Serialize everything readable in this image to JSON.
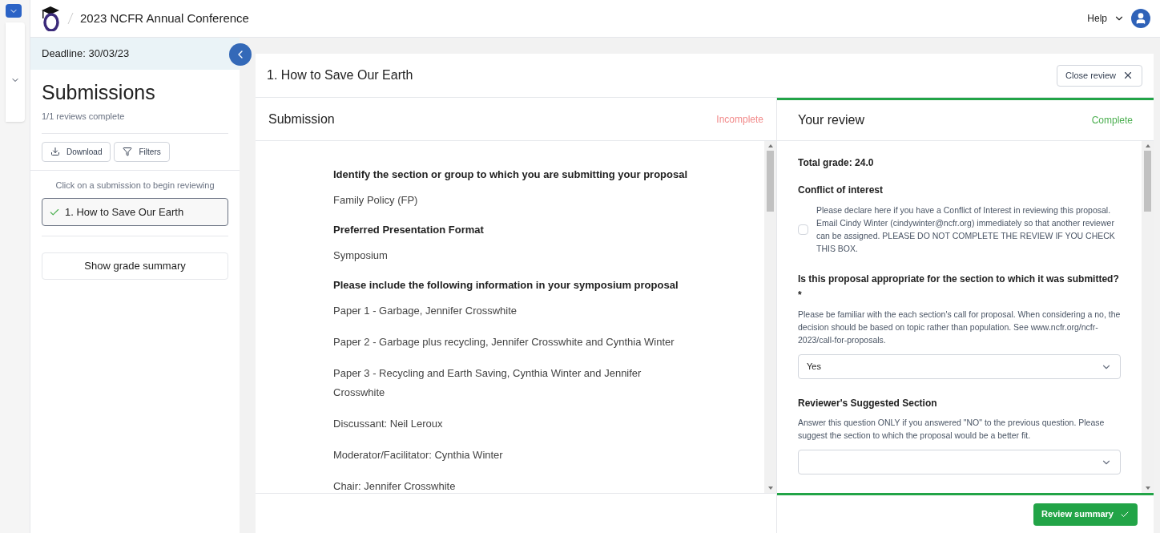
{
  "header": {
    "title": "2023 NCFR Annual Conference",
    "help": "Help"
  },
  "sidebar": {
    "deadline": "Deadline: 30/03/23",
    "title": "Submissions",
    "progress": "1/1 reviews complete",
    "buttons": [
      "Download",
      "Filters"
    ],
    "hint": "Click on a submission to begin reviewing",
    "items": [
      {
        "label": "1. How to Save Our Earth",
        "selected": true,
        "completed": true
      }
    ],
    "summary_button": "Show grade summary"
  },
  "main": {
    "title": "1. How to Save Our Earth",
    "close_button": "Close review",
    "submission": {
      "title": "Submission",
      "status": {
        "kind": "incomplete",
        "text": "Incomplete"
      },
      "blocks": [
        {
          "kind": "question",
          "text": "Identify the section or group to which you are submitting your proposal"
        },
        {
          "kind": "answer",
          "text": "Family Policy (FP)"
        },
        {
          "kind": "question",
          "text": "Preferred Presentation Format"
        },
        {
          "kind": "answer",
          "text": "Symposium"
        },
        {
          "kind": "question",
          "text": "Please include the following information in your symposium proposal"
        },
        {
          "kind": "answer",
          "text": "Paper 1 - Garbage, Jennifer Crosswhite"
        },
        {
          "kind": "answer",
          "text": "Paper 2 - Garbage plus recycling, Jennifer Crosswhite and Cynthia Winter"
        },
        {
          "kind": "answer",
          "text": "Paper 3 - Recycling and Earth Saving, Cynthia Winter and Jennifer Crosswhite"
        },
        {
          "kind": "answer",
          "text": "Discussant: Neil Leroux"
        },
        {
          "kind": "answer",
          "text": "Moderator/Facilitator: Cynthia Winter"
        },
        {
          "kind": "answer",
          "text": "Chair: Jennifer Crosswhite"
        }
      ]
    },
    "review": {
      "title": "Your review",
      "status": {
        "kind": "complete",
        "text": "Complete"
      },
      "total": "Total grade: 24.0",
      "fields": [
        {
          "kind": "checkbox",
          "label": "Conflict of interest",
          "text": "Please declare here if you have a Conflict of Interest in reviewing this proposal. Email Cindy Winter (cindywinter@ncfr.org) immediately so that another reviewer can be assigned. PLEASE DO NOT COMPLETE THE REVIEW IF YOU CHECK THIS BOX.",
          "checked": false
        },
        {
          "kind": "select",
          "label": "Is this proposal appropriate for the section to which it was submitted? *",
          "help": "Please be familiar with the each section's call for proposal. When considering a no, the decision should be based on topic rather than population. See www.ncfr.org/ncfr-2023/call-for-proposals.",
          "value": "Yes"
        },
        {
          "kind": "select",
          "label": "Reviewer's Suggested Section",
          "help": "Answer this question ONLY if you answered \"NO\" to the previous question. Please suggest the section to which the proposal would be a better fit."
        }
      ],
      "summary_button": "Review summary"
    }
  }
}
